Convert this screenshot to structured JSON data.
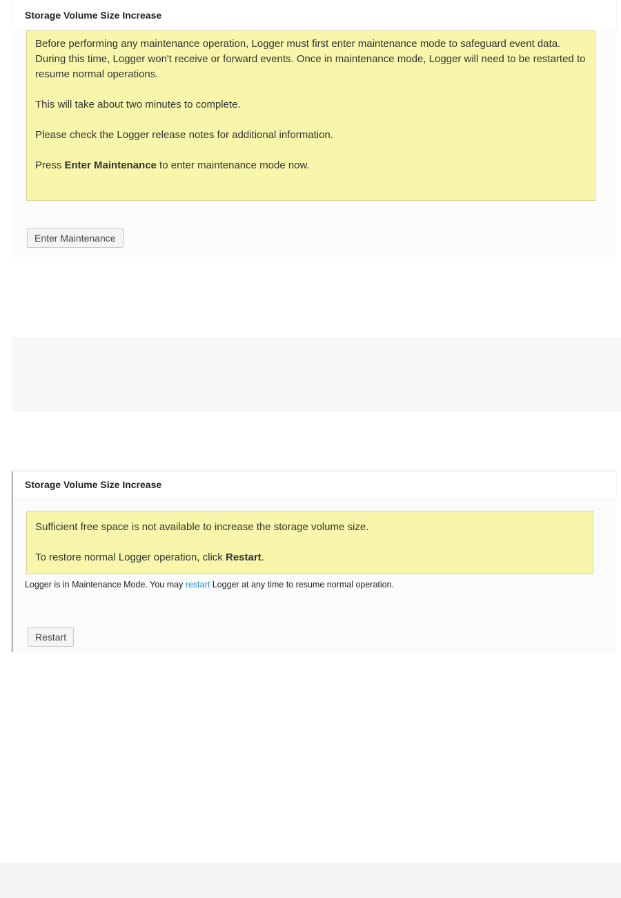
{
  "panel1": {
    "title": "Storage Volume Size Increase",
    "notice": {
      "line1": "Before performing any maintenance operation, Logger must first enter maintenance mode to safeguard event data. During this time, Logger won't receive or forward events. Once in maintenance mode, Logger will need to be restarted to resume normal operations.",
      "line2": "This will take about two minutes to complete.",
      "line3": "Please check the Logger release notes for additional information.",
      "line4_prefix": "Press ",
      "line4_bold": "Enter Maintenance",
      "line4_suffix": " to enter maintenance mode now."
    },
    "button_label": "Enter Maintenance"
  },
  "panel2": {
    "title": "Storage Volume Size Increase",
    "notice": {
      "line1": "Sufficient free space is not available to increase the storage volume size.",
      "line2_prefix": "To restore normal Logger operation, click ",
      "line2_bold": "Restart",
      "line2_suffix": "."
    },
    "info": {
      "prefix": "Logger is in Maintenance Mode. You may ",
      "link": "restart",
      "suffix": " Logger at any time to resume normal operation."
    },
    "button_label": "Restart"
  }
}
